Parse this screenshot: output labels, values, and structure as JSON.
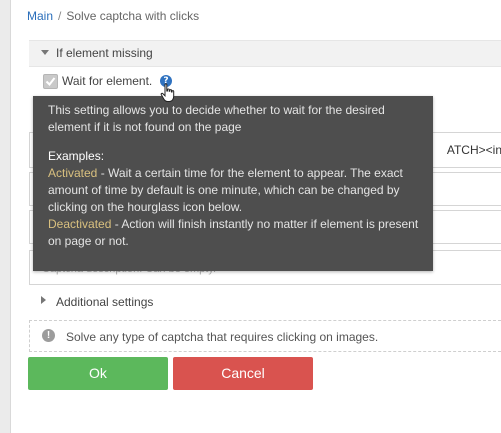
{
  "breadcrumb": {
    "home": "Main",
    "separator": "/",
    "current": "Solve captcha with clicks"
  },
  "section_missing": {
    "title": "If element missing"
  },
  "wait_option": {
    "label": "Wait for element.",
    "checked": true,
    "help_icon": "?"
  },
  "fields": {
    "field1_tail": "ATCH><in",
    "field4_placeholder": "Captcha description. Can be empty."
  },
  "tooltip": {
    "description": "This setting allows you to decide whether to wait for the desired element if it is not found on the page",
    "examples_heading": "Examples:",
    "activated_key": "Activated",
    "activated_text": " - Wait a certain time for the element to appear. The exact amount of time by default is one minute, which can be changed by clicking on the hourglass icon below.",
    "deactivated_key": "Deactivated",
    "deactivated_text": " - Action will finish instantly no matter if element is present on page or not."
  },
  "section_additional": {
    "title": "Additional settings"
  },
  "info": {
    "icon": "!",
    "text": "Solve any type of captcha that requires clicking on images."
  },
  "buttons": {
    "ok": "Ok",
    "cancel": "Cancel"
  },
  "colors": {
    "ok": "#5cb85c",
    "cancel": "#d9534f",
    "link": "#2a6ebb",
    "tooltip_bg": "#4e4e4e",
    "tooltip_key": "#d9c07f"
  }
}
